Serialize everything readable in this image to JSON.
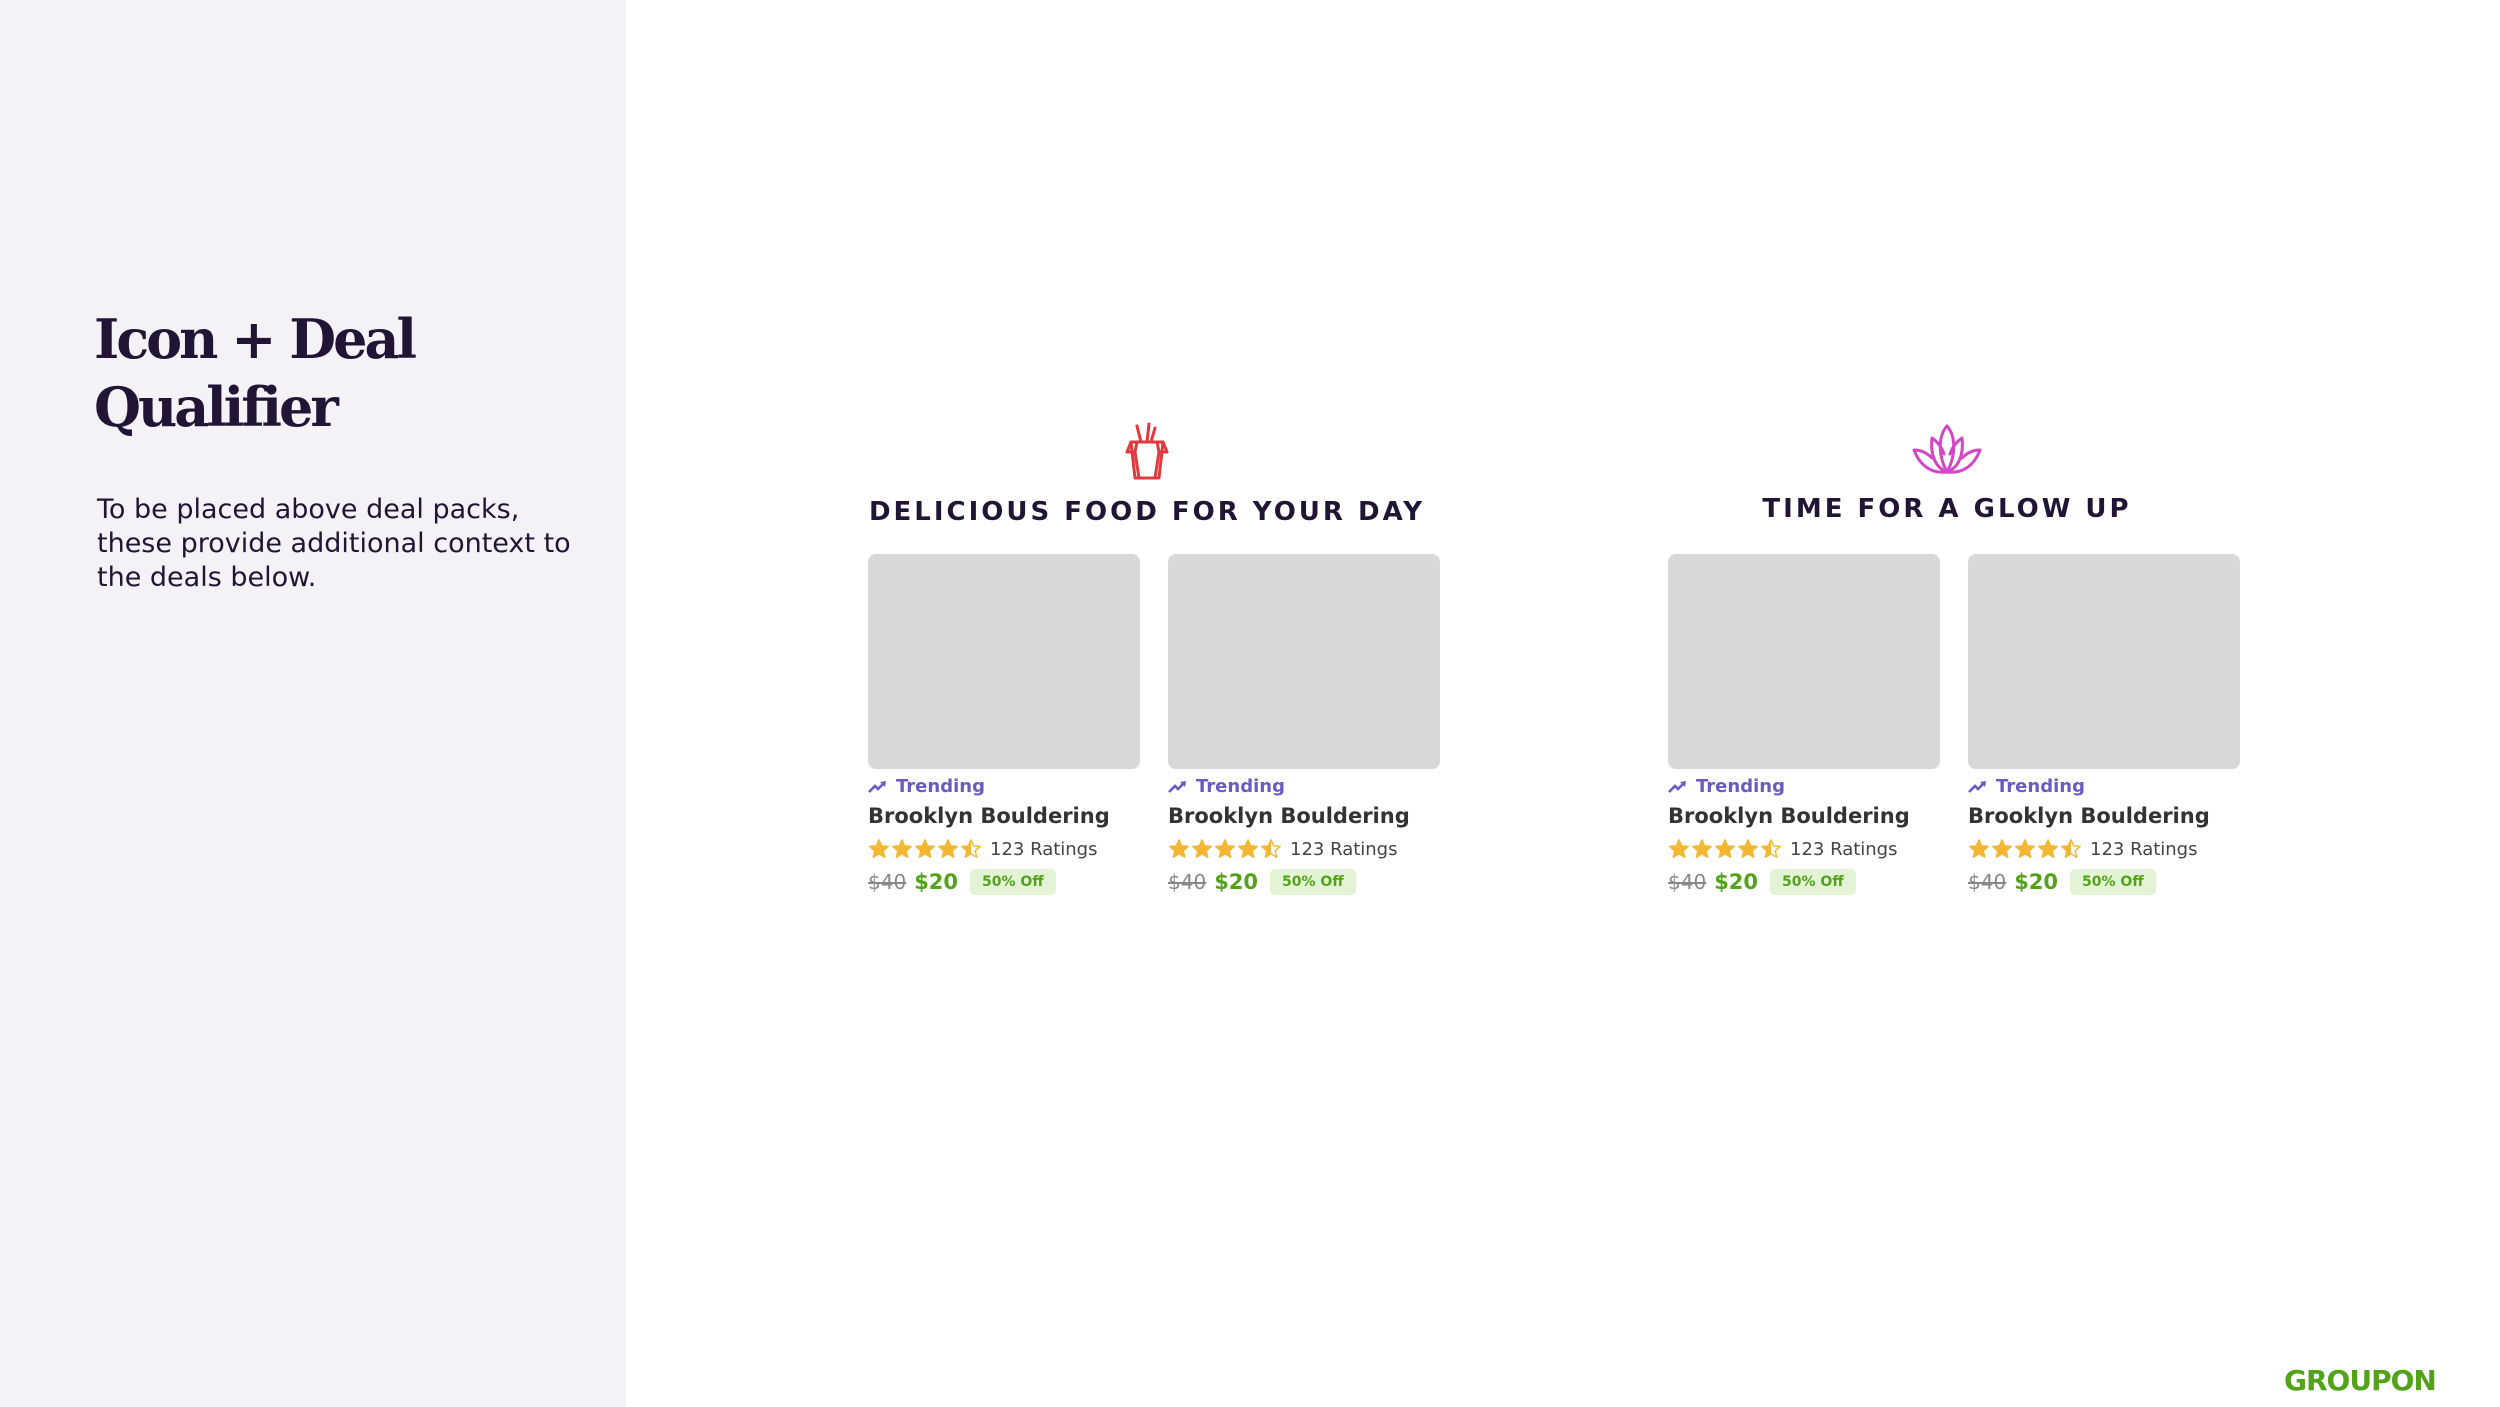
{
  "sidebar": {
    "title": "Icon + Deal Qualifier",
    "description": "To be placed above deal packs, these provide additional context to the deals below."
  },
  "packs": [
    {
      "icon": "takeout-box-icon",
      "icon_color": "#e0393e",
      "heading": "DELICIOUS FOOD FOR YOUR DAY",
      "cards": [
        {
          "trending": "Trending",
          "title": "Brooklyn Bouldering",
          "rating": 4.5,
          "ratings_text": "123 Ratings",
          "old_price": "$40",
          "new_price": "$20",
          "discount": "50% Off"
        },
        {
          "trending": "Trending",
          "title": "Brooklyn Bouldering",
          "rating": 4.5,
          "ratings_text": "123 Ratings",
          "old_price": "$40",
          "new_price": "$20",
          "discount": "50% Off"
        }
      ]
    },
    {
      "icon": "lotus-icon",
      "icon_color": "#d346c4",
      "heading": "TIME FOR A GLOW UP",
      "cards": [
        {
          "trending": "Trending",
          "title": "Brooklyn Bouldering",
          "rating": 4.5,
          "ratings_text": "123 Ratings",
          "old_price": "$40",
          "new_price": "$20",
          "discount": "50% Off"
        },
        {
          "trending": "Trending",
          "title": "Brooklyn Bouldering",
          "rating": 4.5,
          "ratings_text": "123 Ratings",
          "old_price": "$40",
          "new_price": "$20",
          "discount": "50% Off"
        }
      ]
    }
  ],
  "colors": {
    "trending": "#6a5bc4",
    "star": "#f4b731",
    "price": "#53a318",
    "brand": "#53a318"
  },
  "logo": "GROUPON"
}
